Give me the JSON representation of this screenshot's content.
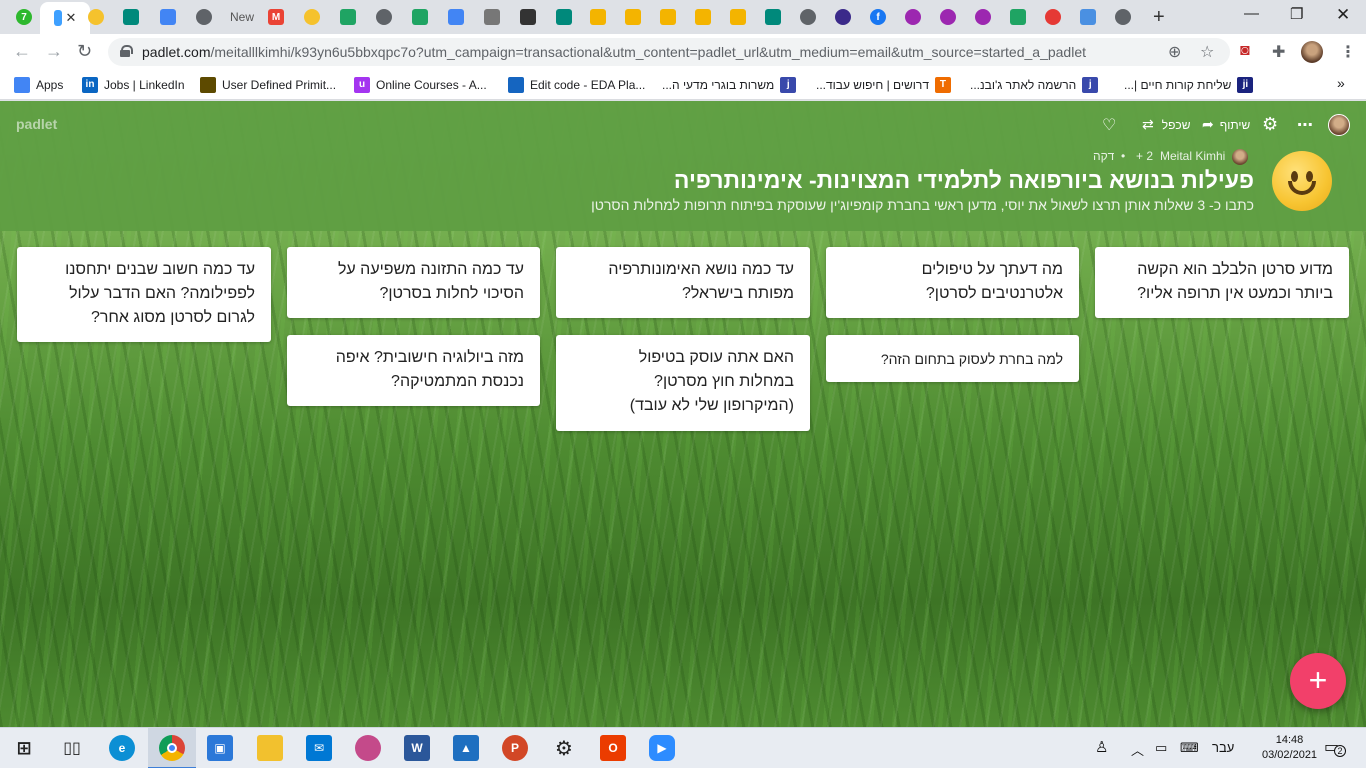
{
  "browser": {
    "tabs": [
      {
        "icon": "green-circle-7-icon",
        "text": "7",
        "color": "#2eb82e"
      },
      {
        "icon": "active-tab-favicon",
        "text": "",
        "color": "#3ea0ff"
      },
      {
        "icon": "emoji-favicon",
        "text": "",
        "color": "#f5c22d"
      },
      {
        "icon": "meet-icon",
        "text": "",
        "color": "#00897b"
      },
      {
        "icon": "docs-icon",
        "text": "",
        "color": "#4285f4"
      },
      {
        "icon": "globe-icon",
        "text": "",
        "color": "#5f6368"
      },
      {
        "icon": "new-tab-favicon",
        "text": "",
        "color": "#999999"
      },
      {
        "icon": "gmail-icon",
        "text": "M",
        "color": "#ea4335"
      },
      {
        "icon": "emoji-favicon",
        "text": "",
        "color": "#f5c22d"
      },
      {
        "icon": "drive-icon",
        "text": "",
        "color": "#1fa463"
      },
      {
        "icon": "globe-icon",
        "text": "",
        "color": "#5f6368"
      },
      {
        "icon": "drive-icon",
        "text": "",
        "color": "#1fa463"
      },
      {
        "icon": "docs-icon",
        "text": "",
        "color": "#4285f4"
      },
      {
        "icon": "app-favicon",
        "text": "",
        "color": "#777777"
      },
      {
        "icon": "classroom-icon",
        "text": "",
        "color": "#333333"
      },
      {
        "icon": "meet-icon",
        "text": "",
        "color": "#00897b"
      },
      {
        "icon": "slides-icon",
        "text": "",
        "color": "#f4b400"
      },
      {
        "icon": "slides-icon",
        "text": "",
        "color": "#f4b400"
      },
      {
        "icon": "slides-icon",
        "text": "",
        "color": "#f4b400"
      },
      {
        "icon": "slides-icon",
        "text": "",
        "color": "#f4b400"
      },
      {
        "icon": "slides-icon",
        "text": "",
        "color": "#f4b400"
      },
      {
        "icon": "meet-icon",
        "text": "",
        "color": "#00897b"
      },
      {
        "icon": "globe-icon",
        "text": "",
        "color": "#5f6368"
      },
      {
        "icon": "keyhole-icon",
        "text": "",
        "color": "#3b2a8a"
      },
      {
        "icon": "facebook-icon",
        "text": "f",
        "color": "#1877f2"
      },
      {
        "icon": "colorful-icon",
        "text": "",
        "color": "#9c27b0"
      },
      {
        "icon": "colorful-icon",
        "text": "",
        "color": "#9c27b0"
      },
      {
        "icon": "colorful-icon",
        "text": "",
        "color": "#9c27b0"
      },
      {
        "icon": "drive-icon",
        "text": "",
        "color": "#1fa463"
      },
      {
        "icon": "colorful-icon",
        "text": "",
        "color": "#e53935"
      },
      {
        "icon": "grid-icon",
        "text": "",
        "color": "#4a90e2"
      },
      {
        "icon": "globe-icon",
        "text": "",
        "color": "#5f6368"
      }
    ],
    "new_tab_label": "New",
    "url_host": "padlet.com",
    "url_rest": "/meitalllkimhi/k93yn6u5bbxqpc7o?utm_campaign=transactional&utm_content=padlet_url&utm_medium=email&utm_source=started_a_padlet",
    "bookmarks": [
      {
        "label": "Apps",
        "icon": "apps-grid-icon",
        "color": "#4285f4",
        "rtl": false
      },
      {
        "label": "Jobs | LinkedIn",
        "icon": "linkedin-icon",
        "color": "#0a66c2",
        "rtl": false
      },
      {
        "label": "User Defined Primit...",
        "icon": "bookmark-icon",
        "color": "#5d4a00",
        "rtl": false
      },
      {
        "label": "Online Courses - A...",
        "icon": "udemy-icon",
        "color": "#a435f0",
        "rtl": false
      },
      {
        "label": "Edit code - EDA Pla...",
        "icon": "eda-icon",
        "color": "#1565c0",
        "rtl": false
      },
      {
        "label": "משרות בוגרי מדעי ה...",
        "icon": "jobs-icon",
        "color": "#3949ab",
        "rtl": true
      },
      {
        "label": "דרושים | חיפוש עבוד...",
        "icon": "tnuva-icon",
        "color": "#ef6c00",
        "rtl": true
      },
      {
        "label": "הרשמה לאתר ג'ובנ...",
        "icon": "jobs-icon",
        "color": "#3949ab",
        "rtl": true
      },
      {
        "label": "שליחת קורות חיים |...",
        "icon": "jobnet-icon",
        "color": "#1a237e",
        "rtl": true
      }
    ]
  },
  "padlet": {
    "logo": "padlet",
    "share_label": "שיתוף",
    "remake_label": "שכפל",
    "author": "Meital Kimhi",
    "contributors": "+ 2",
    "time_ago": "דקה",
    "title": "פעילות בנושא ביורפואה לתלמידי המצוינות- אימינותרפיה",
    "description": "כתבו כ- 3 שאלות אותן תרצו לשאול את יוסי, מדען ראשי בחברת קומפיוג'ין שעוסקת בפיתוח תרופות למחלות הסרטן",
    "posts": [
      {
        "text": "מדוע סרטן הלבלב הוא הקשה\nביותר וכמעט אין תרופה אליו?"
      },
      {
        "text": "מה דעתך על טיפולים\nאלטרנטיבים לסרטן?"
      },
      {
        "text": "למה בחרת לעסוק בתחום הזה?"
      },
      {
        "text": "עד כמה נושא האימונותרפיה\nמפותח בישראל?"
      },
      {
        "text": "האם אתה עוסק  בטיפול\nבמחלות חוץ מסרטן?\n(המיקרופון שלי לא עובד)"
      },
      {
        "text": "עד כמה התזונה משפיעה על\nהסיכוי לחלות בסרטן?"
      },
      {
        "text": "מזה ביולוגיה חישובית? איפה\nנכנסת המתמטיקה?"
      },
      {
        "text": "עד כמה חשוב שבנים יתחסנו\nלפפילומה? האם הדבר עלול\nלגרום לסרטן מסוג אחר?"
      }
    ],
    "fab_label": "+",
    "accent": "#f2406a",
    "header_color": "#5f9e43"
  },
  "taskbar": {
    "apps": [
      {
        "icon": "windows-start-icon",
        "color": "#1f6fd6"
      },
      {
        "icon": "task-view-icon",
        "color": "#333333"
      },
      {
        "icon": "edge-icon",
        "color": "#0c8fd4"
      },
      {
        "icon": "chrome-icon",
        "color": "#db4437"
      },
      {
        "icon": "store-icon",
        "color": "#2b78d8"
      },
      {
        "icon": "file-explorer-icon",
        "color": "#f2c12e"
      },
      {
        "icon": "mail-icon",
        "color": "#0078d4"
      },
      {
        "icon": "paint-icon",
        "color": "#c44a8a"
      },
      {
        "icon": "word-icon",
        "color": "#2b579a"
      },
      {
        "icon": "photos-icon",
        "color": "#1e6fc0"
      },
      {
        "icon": "powerpoint-icon",
        "color": "#d24726"
      },
      {
        "icon": "settings-gear-icon",
        "color": "#222222"
      },
      {
        "icon": "office-icon",
        "color": "#eb3c00"
      },
      {
        "icon": "zoom-icon",
        "color": "#2d8cff"
      }
    ],
    "language": "עבר",
    "time": "14:48",
    "date": "03/02/2021",
    "notification_count": "2"
  }
}
